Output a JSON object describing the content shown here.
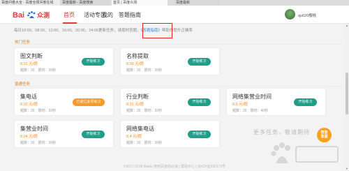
{
  "browser": {
    "tabs": [
      {
        "label": "百度问卷大全 - 百度全球问卷在线"
      },
      {
        "label": "百度最新 - 百度搜索"
      },
      {
        "label": "首页 | 百度众测"
      },
      {
        "label": "百度最新"
      }
    ]
  },
  "header": {
    "logo_text": "Bai度众测",
    "nav": [
      {
        "label": "首页"
      },
      {
        "label": "活动专区"
      },
      {
        "label": "我的"
      },
      {
        "label": "答题指南"
      }
    ],
    "username": "qu620樱桃"
  },
  "notice": {
    "prefix": "每日10:00、08:00、12:00、16:00、20:00、24:00更新任务，请按时答题，",
    "link": "《答题指南》",
    "suffix": "帮助你提升正确率"
  },
  "sections": [
    {
      "title": "热门任务",
      "cards": [
        {
          "name": "图文判断",
          "price": "0.01 元/题",
          "meta": "题数：20　限时：20秒",
          "button": "开始练习",
          "button_style": "green"
        },
        {
          "name": "名称提取",
          "price": "0.03 元/题",
          "meta": "题数：20　限时：20秒",
          "button": "开始练习",
          "button_style": "green"
        }
      ]
    },
    {
      "title": "普通任务",
      "cards": [
        {
          "name": "集电话",
          "price": "0.02 元/题",
          "meta": "题数：20　限时：20秒",
          "button": "已通过此项练习",
          "button_style": "orange"
        },
        {
          "name": "行业判断",
          "price": "0.01 元/题",
          "meta": "题数：20　限时：20秒",
          "button": "开始练习",
          "button_style": "green"
        },
        {
          "name": "网络集营业时间",
          "price": "0.5 元/题",
          "meta": "题数：20　限时：40秒",
          "button": "开始练习",
          "button_style": "green"
        },
        {
          "name": "集营业时间",
          "price": "0.04 元/题",
          "meta": "题数：20　限时：20秒",
          "button": "开始练习",
          "button_style": "green"
        },
        {
          "name": "网络集电话",
          "price": "0.4 元/题",
          "meta": "题数：20　限时：20秒",
          "button": "开始练习",
          "button_style": "green"
        }
      ]
    }
  ],
  "more_text": "更多任务，敬请期待",
  "helper": {
    "line1": "智能",
    "line2": "客服"
  },
  "footer": "©2017-2018 Baidu 使用百度前必读 | 帮助中心 | 京ICP证030173号",
  "colors": {
    "accent_red": "#e3393c",
    "button_green": "#1f9e8a",
    "button_orange": "#f59a2c",
    "price_orange": "#f28b1e",
    "highlight_box": "#e32222"
  }
}
